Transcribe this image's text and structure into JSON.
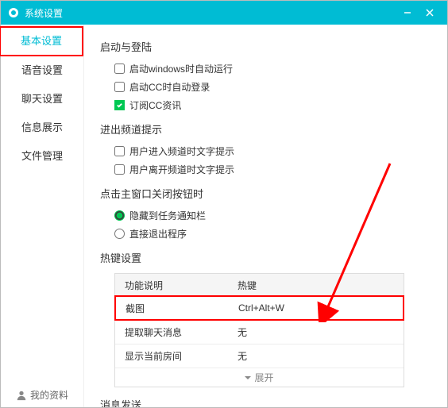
{
  "titlebar": {
    "title": "系统设置"
  },
  "sidebar": {
    "items": [
      {
        "label": "基本设置"
      },
      {
        "label": "语音设置"
      },
      {
        "label": "聊天设置"
      },
      {
        "label": "信息展示"
      },
      {
        "label": "文件管理"
      }
    ],
    "profile": "我的资料"
  },
  "sections": {
    "startup": {
      "title": "启动与登陆",
      "opts": [
        {
          "label": "启动windows时自动运行"
        },
        {
          "label": "启动CC时自动登录"
        },
        {
          "label": "订阅CC资讯"
        }
      ]
    },
    "channel": {
      "title": "进出频道提示",
      "opts": [
        {
          "label": "用户进入频道时文字提示"
        },
        {
          "label": "用户离开频道时文字提示"
        }
      ]
    },
    "close": {
      "title": "点击主窗口关闭按钮时",
      "opts": [
        {
          "label": "隐藏到任务通知栏"
        },
        {
          "label": "直接退出程序"
        }
      ]
    },
    "hotkey": {
      "title": "热键设置",
      "header": {
        "func": "功能说明",
        "key": "热键"
      },
      "rows": [
        {
          "func": "截图",
          "key": "Ctrl+Alt+W"
        },
        {
          "func": "提取聊天消息",
          "key": "无"
        },
        {
          "func": "显示当前房间",
          "key": "无"
        }
      ],
      "expand": "展开"
    },
    "send": {
      "title": "消息发送"
    }
  }
}
